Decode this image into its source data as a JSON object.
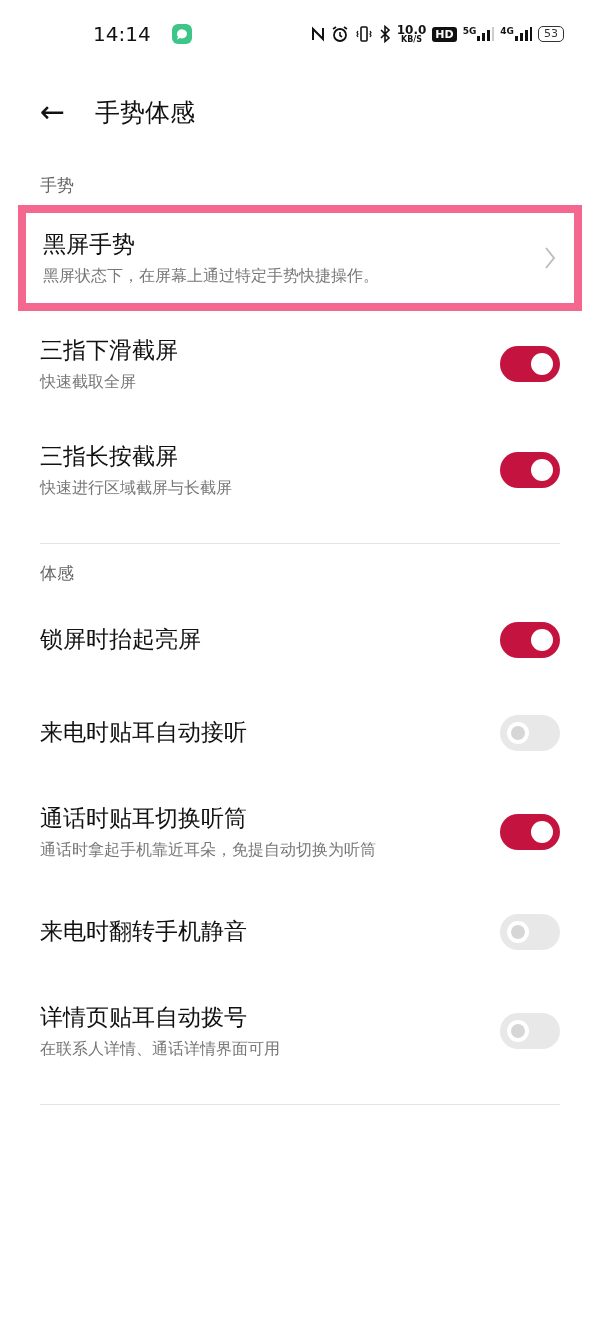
{
  "status_bar": {
    "time": "14:14",
    "speed_value": "10.0",
    "speed_unit": "KB/S",
    "hd": "HD",
    "net_5g": "5G",
    "net_4g": "4G",
    "battery": "53"
  },
  "header": {
    "back": "←",
    "title": "手势体感"
  },
  "sections": [
    {
      "title": "手势",
      "items": [
        {
          "kind": "link",
          "title": "黑屏手势",
          "subtitle": "黑屏状态下，在屏幕上通过特定手势快捷操作。",
          "highlighted": true
        },
        {
          "kind": "toggle",
          "title": "三指下滑截屏",
          "subtitle": "快速截取全屏",
          "on": true
        },
        {
          "kind": "toggle",
          "title": "三指长按截屏",
          "subtitle": "快速进行区域截屏与长截屏",
          "on": true
        }
      ]
    },
    {
      "title": "体感",
      "items": [
        {
          "kind": "toggle",
          "title": "锁屏时抬起亮屏",
          "on": true
        },
        {
          "kind": "toggle",
          "title": "来电时贴耳自动接听",
          "on": false
        },
        {
          "kind": "toggle",
          "title": "通话时贴耳切换听筒",
          "subtitle": "通话时拿起手机靠近耳朵，免提自动切换为听筒",
          "on": true
        },
        {
          "kind": "toggle",
          "title": "来电时翻转手机静音",
          "on": false
        },
        {
          "kind": "toggle",
          "title": "详情页贴耳自动拨号",
          "subtitle": "在联系人详情、通话详情界面可用",
          "on": false
        }
      ]
    }
  ]
}
